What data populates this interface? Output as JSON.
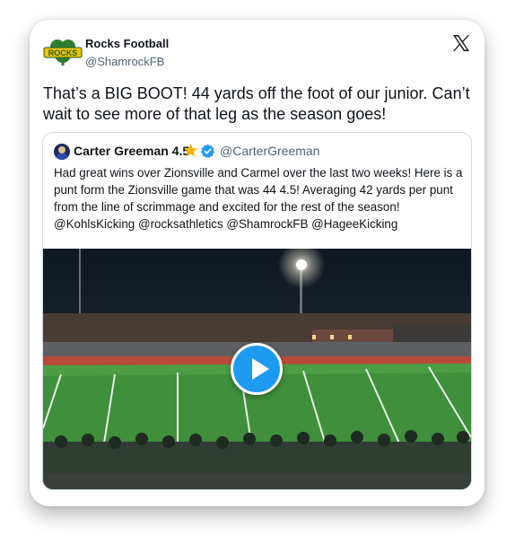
{
  "author": {
    "name": "Rocks Football",
    "handle": "@ShamrockFB",
    "avatar_icon": "shamrock-logo-icon",
    "avatar_logo_text": "ROCKS"
  },
  "platform_icon": "x-logo-icon",
  "tweet": {
    "text": "That’s a BIG BOOT! 44 yards off the foot of our junior. Can’t wait to see more of that leg as the season goes!"
  },
  "quoted_tweet": {
    "author_name": "Carter Greeman 4.5",
    "author_handle": "@CarterGreeman",
    "star_icon": "star-icon",
    "verified_icon": "verified-badge-icon",
    "text": "Had great wins over Zionsville and Carmel over the last two weeks! Here is a punt form the Zionsville game that was 44 4.5! Averaging 42 yards per punt from the line of scrimmage and excited for the rest of the season! @KohlsKicking @rocksathletics @ShamrockFB @HageeKicking",
    "media": {
      "type": "video",
      "play_icon": "play-icon"
    }
  },
  "colors": {
    "accent": "#1d9bf0",
    "text": "#0f1419",
    "muted": "#536471",
    "border": "#cfd9de"
  }
}
